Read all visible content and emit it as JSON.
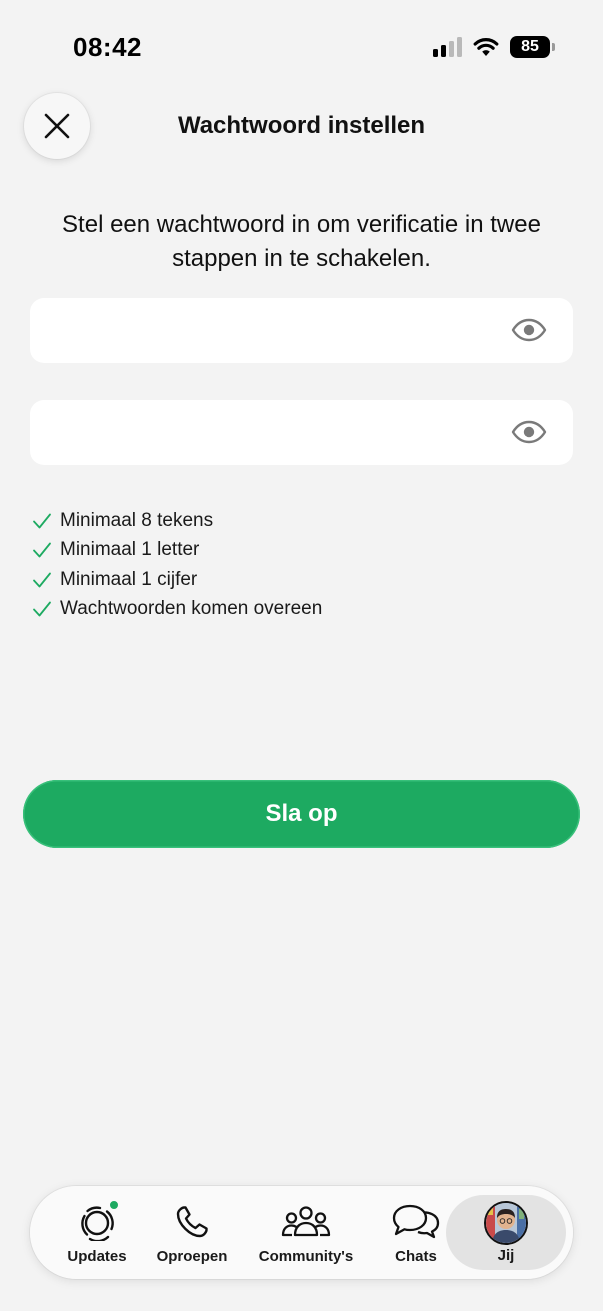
{
  "status_bar": {
    "time": "08:42",
    "battery_level": "85",
    "signal_bars_active": 2,
    "signal_bars_total": 4,
    "icons": [
      "signal-icon",
      "wifi-icon",
      "battery-icon"
    ]
  },
  "header": {
    "title": "Wachtwoord instellen",
    "close_icon": "close-icon"
  },
  "intro_text": "Stel een wachtwoord in om verificatie in twee stappen in te schakelen.",
  "fields": [
    {
      "value": "",
      "placeholder": "",
      "icon": "eye-icon"
    },
    {
      "value": "",
      "placeholder": "",
      "icon": "eye-icon"
    }
  ],
  "requirements": [
    {
      "label": "Minimaal 8 tekens",
      "met": true
    },
    {
      "label": "Minimaal 1 letter",
      "met": true
    },
    {
      "label": "Minimaal 1 cijfer",
      "met": true
    },
    {
      "label": "Wachtwoorden komen overeen",
      "met": true
    }
  ],
  "save_button": {
    "label": "Sla op"
  },
  "tabbar": {
    "tabs": [
      {
        "label": "Updates",
        "icon": "updates-icon",
        "badge": true
      },
      {
        "label": "Oproepen",
        "icon": "phone-icon"
      },
      {
        "label": "Community's",
        "icon": "community-icon"
      },
      {
        "label": "Chats",
        "icon": "chats-icon"
      },
      {
        "label": "Jij",
        "icon": "avatar",
        "selected": true
      }
    ]
  },
  "colors": {
    "accent": "#1daa61",
    "check": "#1daa61",
    "background": "#f3f3f3",
    "field_background": "#ffffff",
    "selected_tab": "#e3e3e3"
  }
}
